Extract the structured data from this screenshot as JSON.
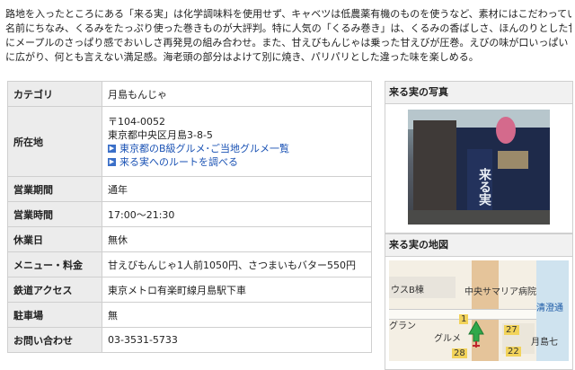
{
  "intro": [
    "路地を入ったところにある「来る実」は化学調味料を使用せず、キャベツは低農薬有機のものを使うなど、素材にはこだわっている。",
    "名前にちなみ、くるみをたっぷり使った巻きものが大評判。特に人気の「くるみ巻き」は、くるみの香ばしさ、ほんのりとした甘さ",
    "にメープルのさっぱり感でおいしさ再発見の組み合わせ。また、甘えびもんじゃは乗った甘えびが圧巻。えびの味が口いっぱい",
    "に広がり、何とも言えない満足感。海老頭の部分はよけて別に焼き、パリパリとした違った味を楽しめる。"
  ],
  "info": {
    "category": {
      "label": "カテゴリ",
      "value": "月島もんじゃ"
    },
    "address": {
      "label": "所在地",
      "postal": "〒104-0052",
      "street": "東京都中央区月島3-8-5",
      "link1": "東京都のB級グルメ･ご当地グルメ一覧",
      "link2": "来る実へのルートを調べる"
    },
    "period": {
      "label": "営業期間",
      "value": "通年"
    },
    "hours": {
      "label": "営業時間",
      "value": "17:00～21:30"
    },
    "holiday": {
      "label": "休業日",
      "value": "無休"
    },
    "menu": {
      "label": "メニュー・料金",
      "value": "甘えびもんじゃ1人前1050円、さつまいもバター550円"
    },
    "access": {
      "label": "鉄道アクセス",
      "value": "東京メトロ有楽町線月島駅下車"
    },
    "parking": {
      "label": "駐車場",
      "value": "無"
    },
    "contact": {
      "label": "お問い合わせ",
      "value": "03-3531-5733"
    }
  },
  "side": {
    "photo_title": "来る実の写真",
    "map_title": "来る実の地図",
    "photo_sign": "来る実",
    "map_labels": [
      "ウスB棟",
      "中央サマリア病院",
      "清澄通",
      "グラン",
      "グルメ",
      "月島七",
      "27",
      "28",
      "22",
      "1"
    ]
  }
}
